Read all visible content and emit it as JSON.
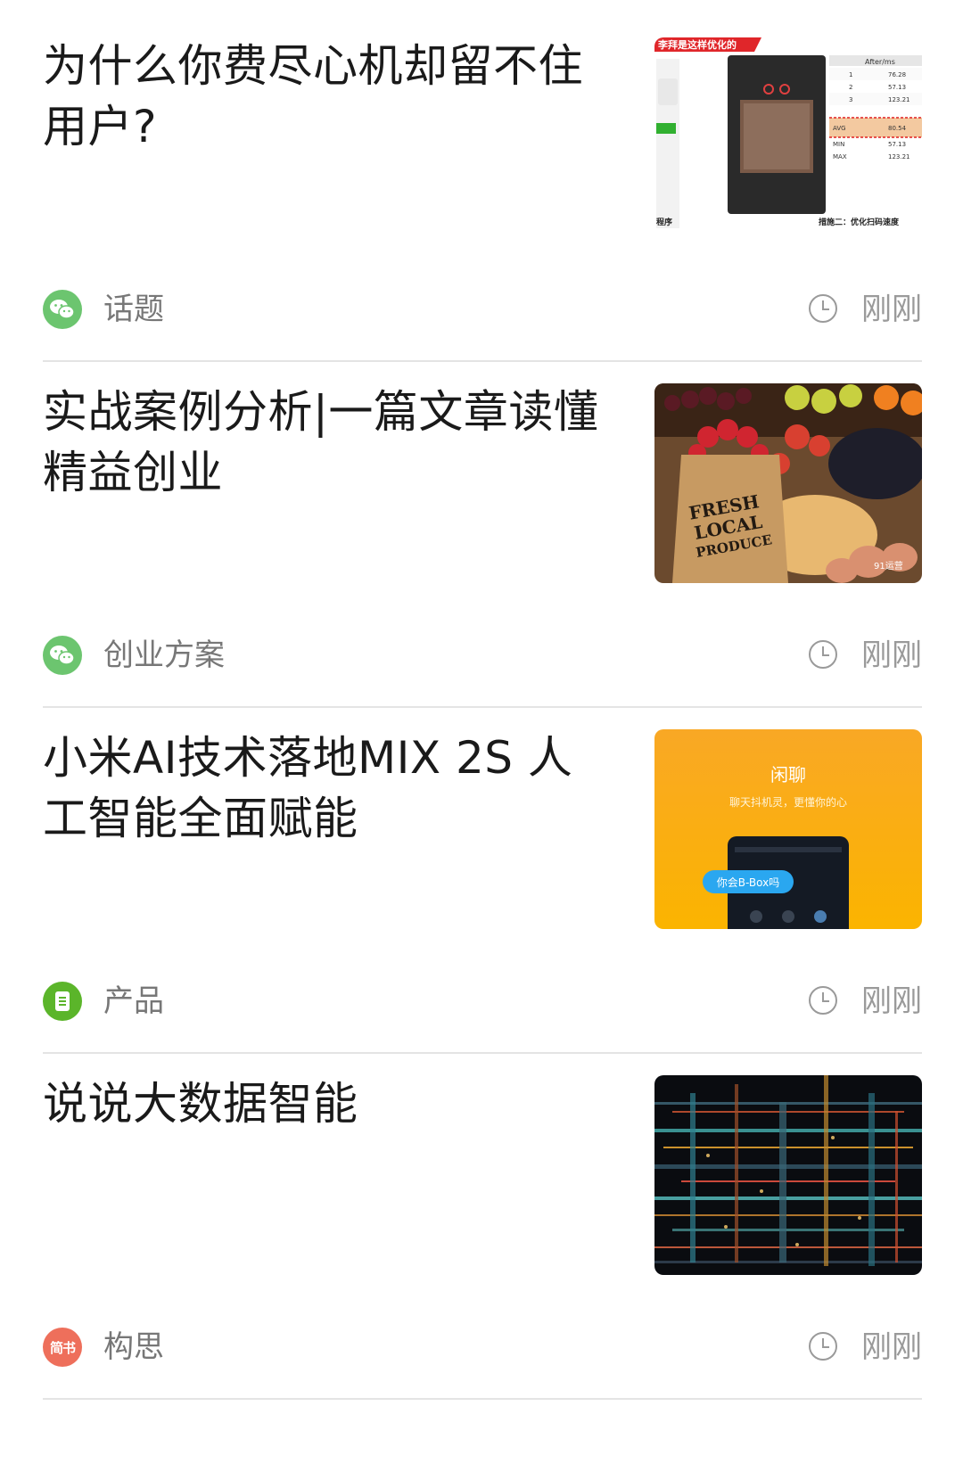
{
  "articles": [
    {
      "title": "为什么你费尽心机却留不住用户?",
      "source_icon": "wechat-icon",
      "source": "话题",
      "time_icon": "clock-icon",
      "time": "刚刚",
      "thumb": {
        "header": "李拜是这样优化的",
        "table_head": "After/ms",
        "table_rows": [
          [
            "1",
            "76.28"
          ],
          [
            "2",
            "57.13"
          ],
          [
            "3",
            "123.21"
          ],
          [
            "AVG",
            "80.54"
          ],
          [
            "MIN",
            "57.13"
          ],
          [
            "MAX",
            "123.21"
          ]
        ],
        "caption_left": "程序",
        "caption_right": "措施二：优化扫码速度"
      }
    },
    {
      "title": "实战案例分析|一篇文章读懂精益创业",
      "source_icon": "wechat-icon",
      "source": "创业方案",
      "time_icon": "clock-icon",
      "time": "刚刚",
      "thumb": {
        "bag_lines": [
          "FRESH",
          "LOCAL",
          "PRODUCE"
        ],
        "watermark": "91运营"
      }
    },
    {
      "title": "小米AI技术落地MIX 2S 人工智能全面赋能",
      "source_icon": "document-icon",
      "source": "产品",
      "time_icon": "clock-icon",
      "time": "刚刚",
      "thumb": {
        "heading": "闲聊",
        "subheading": "聊天抖机灵，更懂你的心",
        "bubble": "你会B-Box吗"
      }
    },
    {
      "title": "说说大数据智能",
      "source_icon": "jianshu-icon",
      "source_badge": "简书",
      "source": "构思",
      "time_icon": "clock-icon",
      "time": "刚刚"
    }
  ],
  "colors": {
    "wechat_green": "#6CC56F",
    "product_green": "#5BB52A",
    "jianshu_red": "#EE6F5B",
    "title_text": "#1a1a1a",
    "meta_text": "#777777",
    "divider": "#e4e4e4"
  }
}
